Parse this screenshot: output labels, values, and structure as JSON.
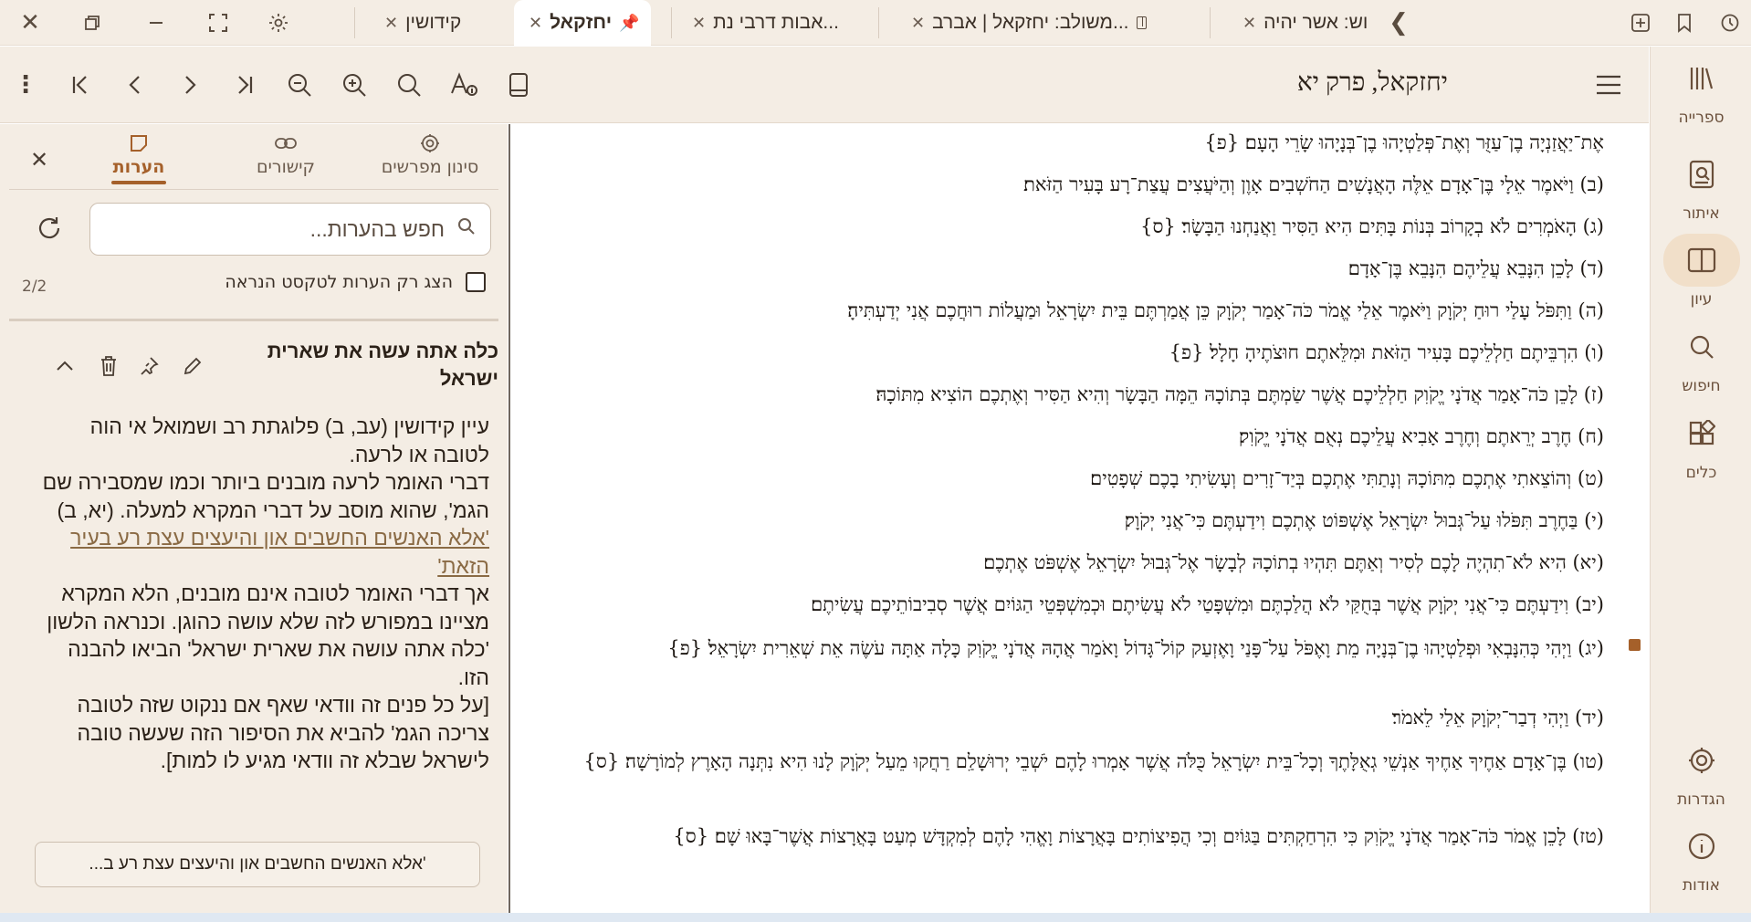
{
  "window_controls": {
    "close": "close-window",
    "restore": "restore",
    "minimize": "minimize",
    "fullscreen": "fullscreen",
    "settings": "settings"
  },
  "tabs": [
    {
      "label": "קידושין",
      "active": false
    },
    {
      "label": "יחזקאל",
      "active": true,
      "pinned": true
    },
    {
      "label": "אבות דרבי נת...",
      "active": false
    },
    {
      "label": "משולב: יחזקאל | אברב...",
      "active": false
    },
    {
      "label": "וש: אשר יהיה",
      "active": false
    }
  ],
  "book_title": "יחזקאל, פרק יא",
  "rail": [
    {
      "label": "ספרייה",
      "icon": "library-icon"
    },
    {
      "label": "איתור",
      "icon": "locate-icon"
    },
    {
      "label": "עיון",
      "icon": "book-open-icon",
      "active": true
    },
    {
      "label": "חיפוש",
      "icon": "search-icon"
    },
    {
      "label": "כלים",
      "icon": "tools-icon"
    },
    {
      "label": "הגדרות",
      "icon": "gear-icon"
    },
    {
      "label": "אודות",
      "icon": "info-icon"
    }
  ],
  "panel": {
    "tabs": [
      {
        "label": "סינון מפרשים"
      },
      {
        "label": "קישורים"
      },
      {
        "label": "הערות",
        "active": true
      }
    ],
    "search_placeholder": "חפש בהערות...",
    "filter_label": "הצג רק הערות לטקסט הנראה",
    "count": "2/2",
    "note": {
      "title": "כלה אתה עשה את שארית ישראל",
      "p1": "עיין קידושין (עב, ב) פלוגתת רב ושמואל אי הוה לטובה או לרעה.",
      "p2": "דברי האומר לרעה מובנים ביותר וכמו שמסבירה שם הגמ', שהוא מוסב על דברי המקרא למעלה. (יא, ב)",
      "link": "'אלא האנשים החשבים און והיעצים עצת רע בעיר הזאת'",
      "p3": "אך דברי האומר לטובה אינם מובנים, הלא המקרא מציינו במפורש לזה שלא עושה כהוגן. וכנראה הלשון 'כלה אתה עושה את שארית ישראל' הביאו להבנה הזו.",
      "p4": "[על כל פנים זה וודאי שאף אם ננקוט שזה לטובה צריכה הגמ' להביא את הסיפור הזה שעשה טובה לישראל שבלא זה וודאי מגיע לו למות]."
    },
    "footer_button": "'אלא האנשים החשבים און והיעצים עצת רע ב..."
  },
  "verses": [
    "אֶת־יַאֲזַנְיָה בֶן־עַזֻּר וְאֶת־פְּלַטְיָהוּ בֶן־בְּנָיָהוּ שָׂרֵי הָעָם׃ {פ}",
    "(ב) וַיֹּאמֶר אֵלָי בֶּן־אָדָם אֵלֶּה הָאֲנָשִׁים הַחֹשְׁבִים אָוֶן וְהַיֹּעֲצִים עֲצַת־רָע בָּעִיר הַזֹּאת׃",
    "(ג) הָאֹמְרִים לֹא בְקָרוֹב בְּנוֹת בָּתִּים הִיא הַסִּיר וַאֲנַחְנוּ הַבָּשָׂר׃ {ס}",
    "(ד) לָכֵן הִנָּבֵא עֲלֵיהֶם הִנָּבֵא בֶּן־אָדָם׃",
    "(ה) וַתִּפֹּל עָלַי רוּחַ יְקֹוָק וַיֹּאמֶר אֵלַי אֱמֹר כֹּה־אָמַר יְקֹוָק כֵּן אֲמַרְתֶּם בֵּית יִשְׂרָאֵל וּמַעֲלוֹת רוּחֲכֶם אֲנִי יְדַעְתִּיהָ׃",
    "(ו) הִרְבֵּיתֶם חַלְלֵיכֶם בָּעִיר הַזֹּאת וּמִלֵּאתֶם חוּצֹתֶיהָ חָלָל׃ {פ}",
    "(ז) לָכֵן כֹּה־אָמַר אֲדֹנָי יֱקֹוִק חַלְלֵיכֶם אֲשֶׁר שַׂמְתֶּם בְּתוֹכָהּ הֵמָּה הַבָּשָׂר וְהִיא הַסִּיר וְאֶתְכֶם הוֹצִיא מִתּוֹכָהּ׃",
    "(ח) חֶרֶב יְרֵאתֶם וְחֶרֶב אָבִיא עֲלֵיכֶם נְאֻם אֲדֹנָי יֱקֹוִק׃",
    "(ט) וְהוֹצֵאתִי אֶתְכֶם מִתּוֹכָהּ וְנָתַתִּי אֶתְכֶם בְּיַד־זָרִים וְעָשִׂיתִי בָכֶם שְׁפָטִים׃",
    "(י) בַּחֶרֶב תִּפֹּלוּ עַל־גְּבוּל יִשְׂרָאֵל אֶשְׁפּוֹט אֶתְכֶם וִידַעְתֶּם כִּי־אֲנִי יְקֹוָק׃",
    "(יא) הִיא לֹא־תִהְיֶה לָכֶם לְסִיר וְאַתֶּם תִּהְיוּ בְתוֹכָהּ לְבָשָׂר אֶל־גְּבוּל יִשְׂרָאֵל אֶשְׁפֹּט אֶתְכֶם׃",
    "(יב) וִידַעְתֶּם כִּי־אֲנִי יְקֹוָק אֲשֶׁר בְּחֻקַּי לֹא הֲלַכְתֶּם וּמִשְׁפָּטַי לֹא עֲשִׂיתֶם וּכְמִשְׁפְּטֵי הַגּוֹיִם אֲשֶׁר סְבִיבוֹתֵיכֶם עֲשִׂיתֶם׃",
    "(יג) וַיְהִי כְּהִנָּבְאִי וּפְלַטְיָהוּ בֶן־בְּנָיָה מֵת וָאֶפֹּל עַל־פָּנַי וָאֶזְעַק קוֹל־גָּדוֹל וָאֹמַר אֲהָהּ אֲדֹנָי יֱקֹוִק כָּלָה אַתָּה עֹשֶׂה אֵת שְׁאֵרִית יִשְׂרָאֵל׃ {פ}",
    "(יד) וַיְהִי דְבַר־יְקֹוָק אֵלַי לֵאמֹר׃",
    "(טו) בֶּן־אָדָם אַחֶיךָ אַחֶיךָ אַנְשֵׁי גְאֻלָּתֶךָ וְכָל־בֵּית יִשְׂרָאֵל כֻּלֹּה אֲשֶׁר אָמְרוּ לָהֶם יֹשְׁבֵי יְרוּשָׁלִַם רַחֲקוּ מֵעַל יְקֹוָק לָנוּ הִיא נִתְּנָה הָאָרֶץ לְמוֹרָשָׁה׃ {ס}",
    "(טז) לָכֵן אֱמֹר כֹּה־אָמַר אֲדֹנָי יֱקֹוִק כִּי הִרְחַקְתִּים בַּגּוֹיִם וְכִי הֲפִיצוֹתִים בָּאֲרָצוֹת וָאֱהִי לָהֶם לְמִקְדָּשׁ מְעַט בָּאֲרָצוֹת אֲשֶׁר־בָּאוּ שָׁם׃ {ס}"
  ]
}
